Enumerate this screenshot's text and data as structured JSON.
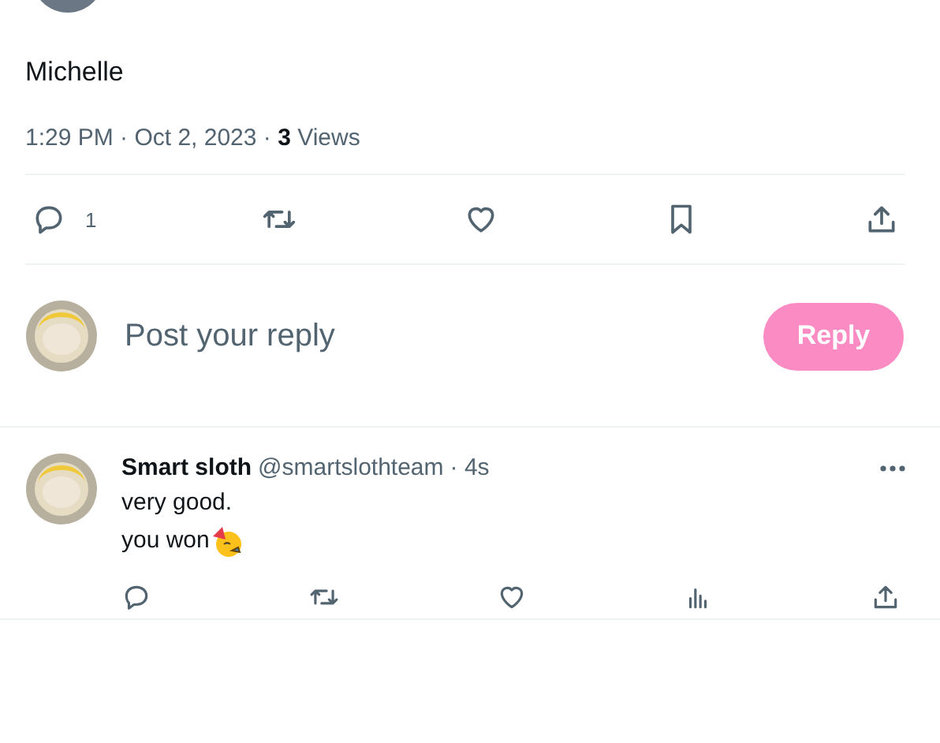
{
  "tweet": {
    "text": "Michelle",
    "meta": "1:29 PM · Oct 2, 2023 · **3** Views",
    "actions": [
      {
        "kind": "reply",
        "count": "1"
      },
      {
        "kind": "repost"
      },
      {
        "kind": "like"
      },
      {
        "kind": "bookmark"
      },
      {
        "kind": "share"
      }
    ]
  },
  "composer": {
    "placeholder": "Post your reply",
    "button": "Reply",
    "disabled": true
  },
  "replies": [
    {
      "name": "Smart sloth",
      "handle": "@smartslothteam",
      "time": "· 4s",
      "lines": [
        "very good.",
        "you won"
      ],
      "actions": [
        {
          "kind": "reply"
        },
        {
          "kind": "repost"
        },
        {
          "kind": "like"
        },
        {
          "kind": "views"
        },
        {
          "kind": "share"
        }
      ]
    }
  ]
}
